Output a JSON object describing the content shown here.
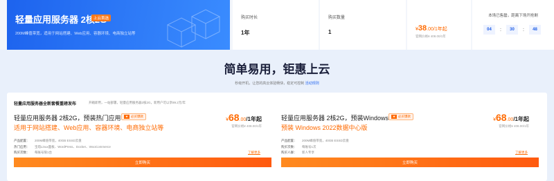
{
  "hero": {
    "title": "轻量应用服务器 2核2G",
    "tag": "上云首选",
    "subtitle": "200M峰值带宽，适用于网站搭建、Web应用、容器环境、电商独立站等"
  },
  "purchase": {
    "duration_label": "购买时长",
    "duration_value": "1年",
    "quantity_label": "购买数量",
    "quantity_value": "1",
    "price_prefix": "¥",
    "price_value": "38",
    "price_suffix": ".00/1年起",
    "orig_price": "官网价格¥ 408.00/1年"
  },
  "countdown": {
    "label": "本场已售罄，距离下场开抢剩",
    "hours": "04",
    "minutes": "30",
    "seconds": "48",
    "sep": ":"
  },
  "section": {
    "title": "简单易用，钜惠上云",
    "subtitle": "秒级开机，让您的高云体验畅快，稳定可控制",
    "subtitle_link": "活动规则"
  },
  "panel": {
    "heading": "轻量应用服务器全新套餐重磅发布",
    "note": "开箱即用，一站部署，轻量应用服务器2核2G，新用户可以享89.2元/年"
  },
  "cards": [
    {
      "title": "轻量应用服务器 2核2G，预装热门应用",
      "badge_mark": "★",
      "badge": "必买爆款",
      "highlight": "适用于网站搭建、Web应用、容器环境、电商独立站等",
      "price_prefix": "¥",
      "price_value": "68",
      "price_decimal": ".00",
      "price_unit": "/1年起",
      "orig": "官网价格¥ 408.00/1年",
      "specs": [
        {
          "k": "产品配置：",
          "v": "200M峰值带宽，40GB ESSD云盘"
        },
        {
          "k": "热门应用：",
          "v": "宝塔Linux面板、WordPress、Docker、WooCommerce"
        },
        {
          "k": "购买次数：",
          "v": "每账号限1台"
        }
      ],
      "more": "了解更多",
      "buy": "立即购买"
    },
    {
      "title": "轻量应用服务器 2核2G，预装Windows",
      "badge_mark": "★",
      "badge": "必买爆款",
      "highlight": "预装 Windows 2022数据中心版",
      "price_prefix": "¥",
      "price_value": "68",
      "price_decimal": ".00",
      "price_unit": "/1年起",
      "orig": "官网价格¥ 408.00/1年",
      "specs": [
        {
          "k": "产品配置：",
          "v": "200M峰值带宽，40GB ESSD云盘"
        },
        {
          "k": "购买次数：",
          "v": "每账号1次"
        },
        {
          "k": "购买人群：",
          "v": "新人专享"
        }
      ],
      "more": "了解更多",
      "buy": "立即购买"
    }
  ]
}
